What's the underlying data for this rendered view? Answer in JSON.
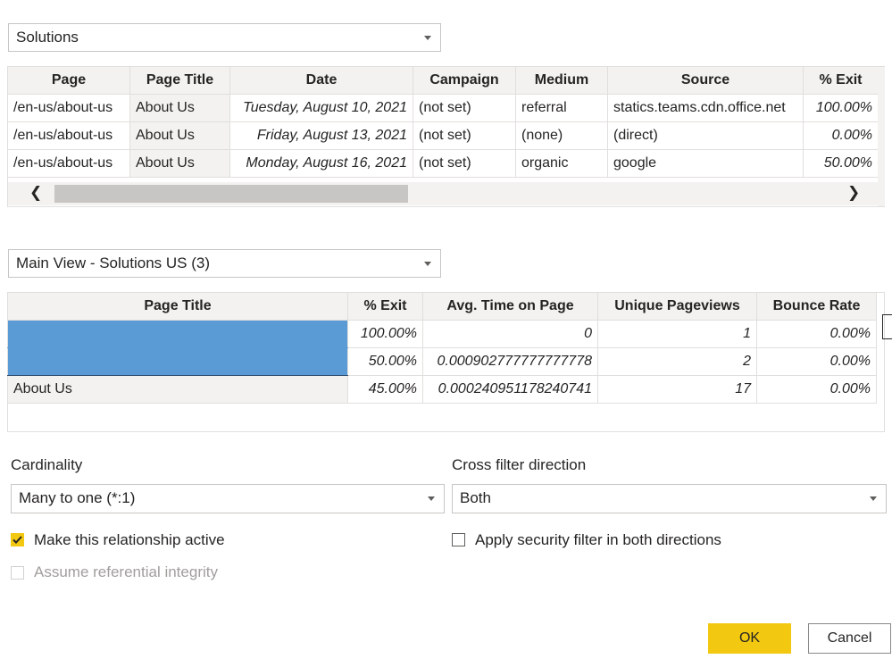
{
  "top_dropdown": {
    "value": "Solutions"
  },
  "top_table": {
    "columns": [
      "Page",
      "Page Title",
      "Date",
      "Campaign",
      "Medium",
      "Source",
      "% Exit"
    ],
    "rows": [
      [
        "/en-us/about-us",
        "About Us",
        "Tuesday, August 10, 2021",
        "(not set)",
        "referral",
        "statics.teams.cdn.office.net",
        "100.00%"
      ],
      [
        "/en-us/about-us",
        "About Us",
        "Friday, August 13, 2021",
        "(not set)",
        "(none)",
        "(direct)",
        "0.00%"
      ],
      [
        "/en-us/about-us",
        "About Us",
        "Monday, August 16, 2021",
        "(not set)",
        "organic",
        "google",
        "50.00%"
      ]
    ],
    "scroll_left": "❮",
    "scroll_right": "❯"
  },
  "bottom_dropdown": {
    "value": "Main View - Solutions US (3)"
  },
  "bottom_table": {
    "columns": [
      "Page Title",
      "% Exit",
      "Avg. Time on Page",
      "Unique Pageviews",
      "Bounce Rate"
    ],
    "rows": [
      [
        "",
        "100.00%",
        "0",
        "1",
        "0.00%"
      ],
      [
        "",
        "50.00%",
        "0.000902777777777778",
        "2",
        "0.00%"
      ],
      [
        "About Us",
        "45.00%",
        "0.000240951178240741",
        "17",
        "0.00%"
      ]
    ]
  },
  "cardinality": {
    "label": "Cardinality",
    "value": "Many to one (*:1)"
  },
  "cross_filter": {
    "label": "Cross filter direction",
    "value": "Both"
  },
  "options": {
    "make_active": {
      "label": "Make this relationship active",
      "checked": true
    },
    "referential": {
      "label": "Assume referential integrity",
      "checked": false,
      "disabled": true
    },
    "security_filter": {
      "label": "Apply security filter in both directions",
      "checked": false
    }
  },
  "buttons": {
    "ok": "OK",
    "cancel": "Cancel"
  },
  "colors": {
    "accent": "#f2c811",
    "selection": "#5b9bd5",
    "checkbox": "#f2c811"
  }
}
